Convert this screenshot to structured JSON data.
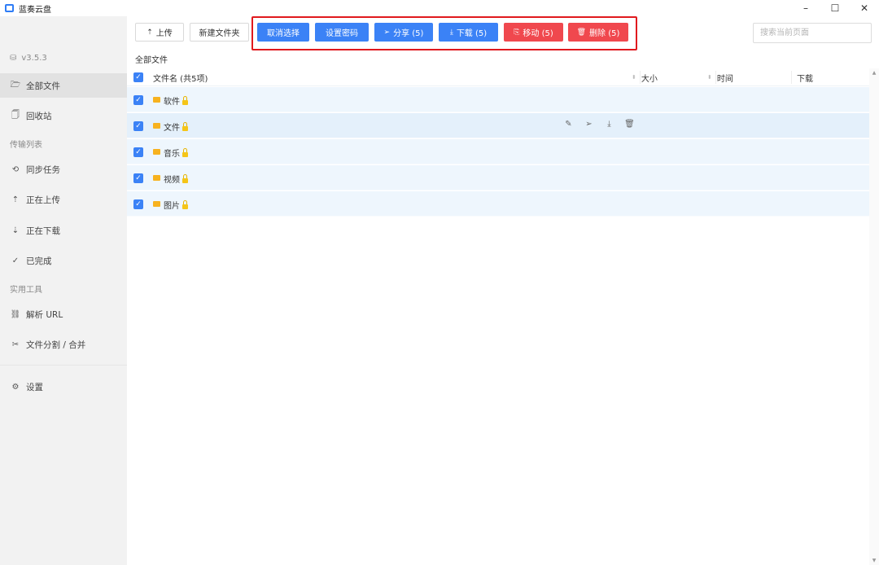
{
  "window": {
    "title": "蓝奏云盘",
    "minimize": "–",
    "maximize": "☐",
    "close": "✕"
  },
  "sidebar": {
    "version": "v3.5.3",
    "items": [
      {
        "label": "全部文件",
        "icon": "folder-open-icon",
        "glyph": "⌓"
      },
      {
        "label": "回收站",
        "icon": "trash-icon",
        "glyph": "🗑"
      }
    ],
    "transfer_section": "传输列表",
    "transfer_items": [
      {
        "label": "同步任务",
        "glyph": "⟲"
      },
      {
        "label": "正在上传",
        "glyph": "⇡"
      },
      {
        "label": "正在下载",
        "glyph": "⇣"
      },
      {
        "label": "已完成",
        "glyph": "✓"
      }
    ],
    "tools_section": "实用工具",
    "tool_items": [
      {
        "label": "解析 URL",
        "glyph": "⛓"
      },
      {
        "label": "文件分割 / 合并",
        "glyph": "✂"
      }
    ],
    "settings": {
      "label": "设置",
      "glyph": "⚙"
    }
  },
  "toolbar": {
    "upload": "上传",
    "new_folder": "新建文件夹",
    "cancel_select": "取消选择",
    "set_password": "设置密码",
    "share": "分享 (5)",
    "download": "下载 (5)",
    "move": "移动 (5)",
    "delete": "删除 (5)",
    "search_placeholder": "搜索当前页面"
  },
  "breadcrumb": "全部文件",
  "table": {
    "headers": {
      "name": "文件名 (共5项)",
      "size": "大小",
      "time": "时间",
      "download": "下载"
    },
    "rows": [
      {
        "name": "软件",
        "locked": true,
        "checked": true
      },
      {
        "name": "文件",
        "locked": true,
        "checked": true
      },
      {
        "name": "音乐",
        "locked": true,
        "checked": true
      },
      {
        "name": "视频",
        "locked": true,
        "checked": true
      },
      {
        "name": "图片",
        "locked": true,
        "checked": true
      }
    ]
  },
  "colors": {
    "primary": "#3b82f6",
    "danger": "#f0484e",
    "highlight_border": "#e0191e",
    "row_selected": "#eef6fd"
  }
}
